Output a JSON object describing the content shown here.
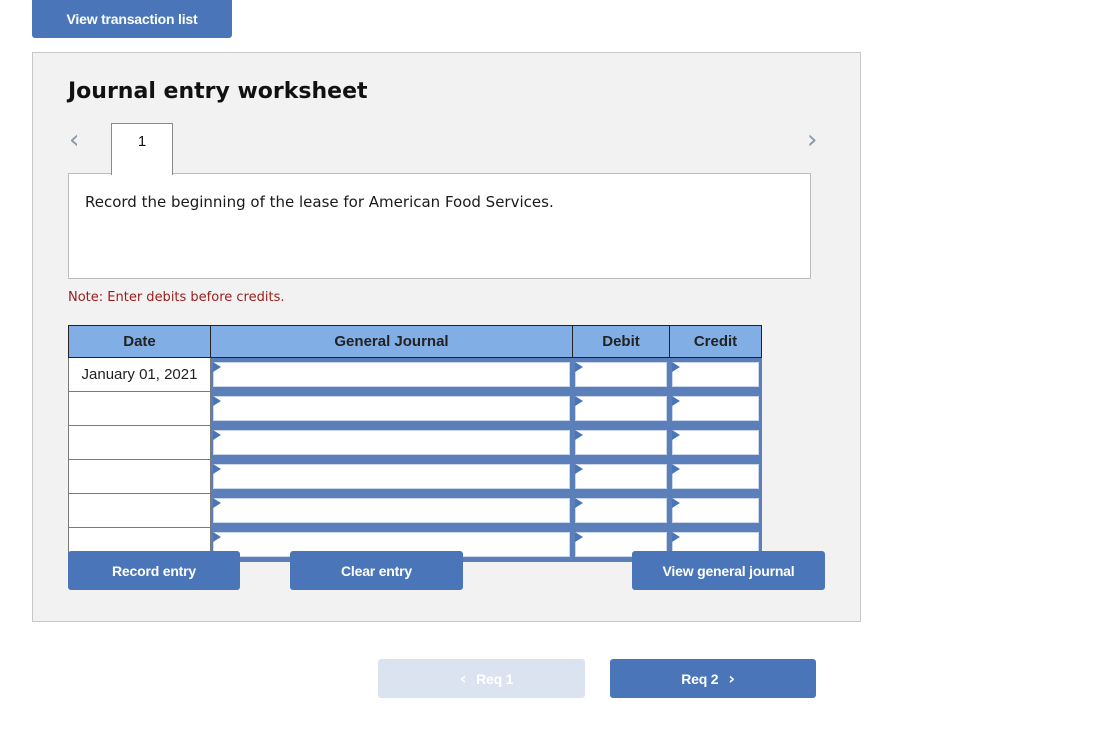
{
  "top_button": {
    "label": "View transaction list"
  },
  "worksheet": {
    "title": "Journal entry worksheet",
    "prev_icon": "chevron-left-icon",
    "next_icon": "chevron-right-icon",
    "prev_glyph": "‹",
    "next_glyph": "›",
    "tabs": [
      {
        "label": "1"
      }
    ],
    "description": "Record the beginning of the lease for American Food Services.",
    "note": "Note: Enter debits before credits.",
    "table": {
      "headers": {
        "date": "Date",
        "general_journal": "General Journal",
        "debit": "Debit",
        "credit": "Credit"
      },
      "rows": [
        {
          "date": "January 01, 2021",
          "account": "",
          "debit": "",
          "credit": ""
        },
        {
          "date": "",
          "account": "",
          "debit": "",
          "credit": ""
        },
        {
          "date": "",
          "account": "",
          "debit": "",
          "credit": ""
        },
        {
          "date": "",
          "account": "",
          "debit": "",
          "credit": ""
        },
        {
          "date": "",
          "account": "",
          "debit": "",
          "credit": ""
        },
        {
          "date": "",
          "account": "",
          "debit": "",
          "credit": ""
        }
      ]
    },
    "buttons": {
      "record": "Record entry",
      "clear": "Clear entry",
      "view_general_journal": "View general journal"
    }
  },
  "pagination": {
    "prev": {
      "label": "Req 1",
      "glyph": "‹",
      "disabled": true
    },
    "next": {
      "label": "Req 2",
      "glyph": "›",
      "disabled": false
    }
  },
  "colors": {
    "button": "#4a76b9",
    "button_disabled": "#dbe3f0",
    "table_header": "#82aee6",
    "note": "#9b1c1c",
    "panel": "#f2f2f2"
  }
}
